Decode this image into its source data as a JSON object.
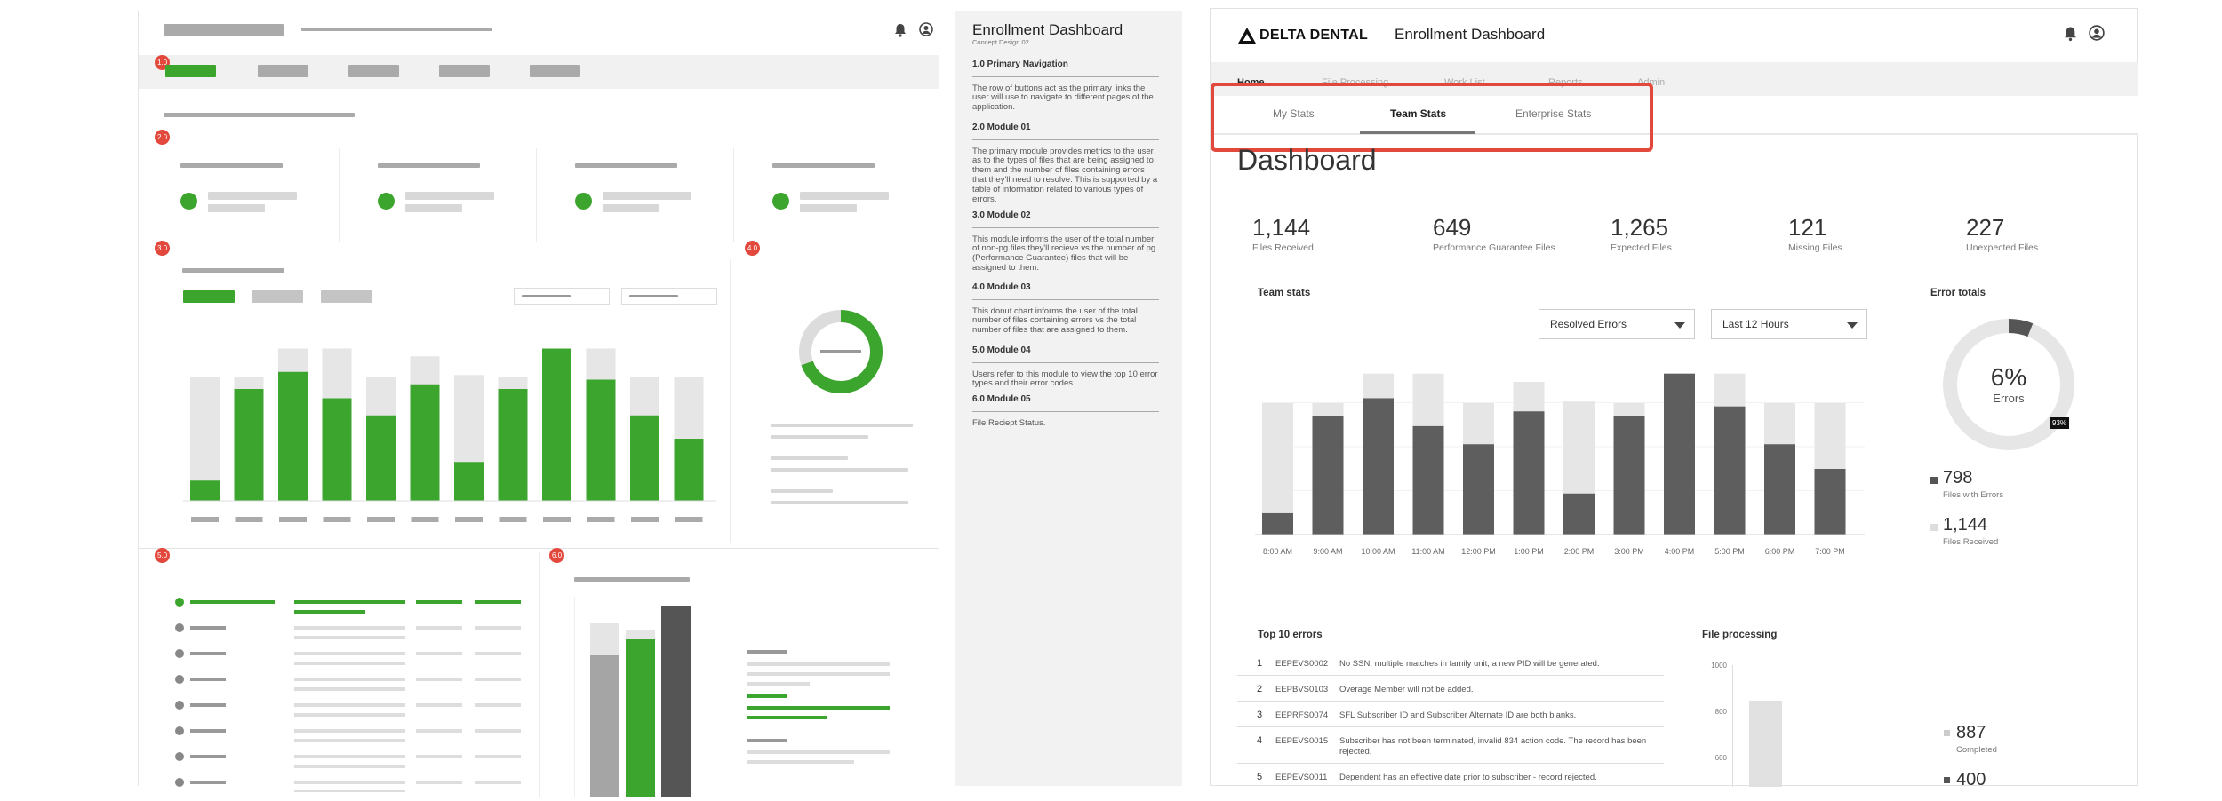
{
  "mid": {
    "title": "Enrollment Dashboard",
    "subtitle": "Concept Design 02",
    "sections": [
      {
        "title": "1.0 Primary Navigation",
        "text": "The row of buttons act as the primary links the user will use to navigate to different pages of the application."
      },
      {
        "title": "2.0 Module 01",
        "text": "The primary module provides metrics to the user as to the types of files that are being assigned to them and the number of files containing errors that they'll need to resolve. This is supported by a table of information related to various types of errors."
      },
      {
        "title": "3.0 Module 02",
        "text": "This module informs the user of the total number of non-pg files they'll recieve vs the number of pg (Performance Guarantee) files that will be assigned to them."
      },
      {
        "title": "4.0 Module 03",
        "text": "This donut chart informs the user of the total number of files containing errors vs the total number of files that are assigned to them."
      },
      {
        "title": "5.0 Module 04",
        "text": "Users refer to this module to view the top 10 error types and their error codes."
      },
      {
        "title": "6.0 Module 05",
        "text": "File Reciept Status."
      }
    ]
  },
  "wire": {
    "badges": [
      "1.0",
      "2.0",
      "3.0",
      "4.0",
      "5.0",
      "6.0"
    ]
  },
  "app": {
    "logo": "DELTA DENTAL",
    "title": "Enrollment Dashboard",
    "nav": [
      "Home",
      "File Processing",
      "Work List",
      "Reports",
      "Admin"
    ],
    "tabs": [
      "My Stats",
      "Team Stats",
      "Enterprise Stats"
    ],
    "active_tab": "Team Stats",
    "page_title": "Dashboard",
    "stats": [
      {
        "value": "1,144",
        "label": "Files Received"
      },
      {
        "value": "649",
        "label": "Performance Guarantee Files"
      },
      {
        "value": "1,265",
        "label": "Expected Files"
      },
      {
        "value": "121",
        "label": "Missing Files"
      },
      {
        "value": "227",
        "label": "Unexpected Files"
      }
    ],
    "team_stats": {
      "title": "Team stats",
      "dropdown1": "Resolved Errors",
      "dropdown2": "Last 12 Hours"
    },
    "error_totals": {
      "title": "Error totals",
      "percent": "6%",
      "label": "Errors",
      "tag": "93%",
      "legend": [
        {
          "value": "798",
          "label": "Files with Errors"
        },
        {
          "value": "1,144",
          "label": "Files Received"
        }
      ]
    },
    "top_errors": {
      "title": "Top 10 errors",
      "rows": [
        {
          "n": "1",
          "code": "EEPEVS0002",
          "desc": "No SSN, multiple matches in family unit, a new PID will be generated."
        },
        {
          "n": "2",
          "code": "EEPBVS0103",
          "desc": "Overage Member will not be added."
        },
        {
          "n": "3",
          "code": "EEPRFS0074",
          "desc": "SFL Subscriber ID and Subscriber Alternate ID are both blanks."
        },
        {
          "n": "4",
          "code": "EEPEVS0015",
          "desc": "Subscriber has not been terminated, invalid 834 action code. The record has been rejected."
        },
        {
          "n": "5",
          "code": "EEPEVS0011",
          "desc": "Dependent has an effective date prior to subscriber - record rejected."
        }
      ]
    },
    "file_processing": {
      "title": "File processing",
      "y_ticks": [
        "1000",
        "800",
        "600"
      ],
      "legend": [
        {
          "value": "887",
          "label": "Completed"
        },
        {
          "value": "400",
          "label": ""
        }
      ]
    }
  },
  "chart_data": {
    "type": "bar",
    "categories": [
      "8:00 AM",
      "9:00 AM",
      "10:00 AM",
      "11:00 AM",
      "12:00 PM",
      "1:00 PM",
      "2:00 PM",
      "3:00 PM",
      "4:00 PM",
      "5:00 PM",
      "6:00 PM",
      "7:00 PM"
    ],
    "series": [
      {
        "name": "",
        "values": [
          13,
          72,
          83,
          66,
          55,
          75,
          25,
          72,
          98,
          78,
          55,
          40
        ]
      },
      {
        "name": "",
        "values": [
          80,
          80,
          98,
          98,
          80,
          93,
          81,
          80,
          98,
          98,
          80,
          80
        ]
      }
    ],
    "ylim": [
      0,
      100
    ],
    "colors": {
      "dark": "#5e5e5e",
      "light": "#e6e6e6"
    }
  }
}
